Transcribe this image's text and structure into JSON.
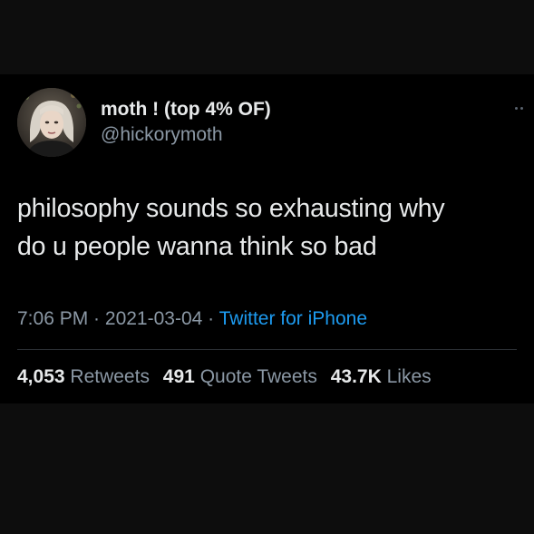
{
  "tweet": {
    "author": {
      "display_name": "moth ! (top 4% OF)",
      "handle": "@hickorymoth"
    },
    "text_lines": [
      "philosophy sounds so exhausting why",
      "do u people wanna think so bad"
    ],
    "time": "7:06 PM",
    "date": "2021-03-04",
    "separator": " · ",
    "source": "Twitter for iPhone",
    "stats": {
      "retweets_count": "4,053",
      "retweets_label": "Retweets",
      "quote_count": "491",
      "quote_label": "Quote Tweets",
      "likes_count": "43.7K",
      "likes_label": "Likes"
    }
  },
  "icons": {
    "more": "more-options-icon"
  },
  "colors": {
    "background": "#000000",
    "text": "#e7e9ea",
    "secondary_text": "#8b98a5",
    "link": "#1d9bf0",
    "divider": "#2a2e33"
  }
}
